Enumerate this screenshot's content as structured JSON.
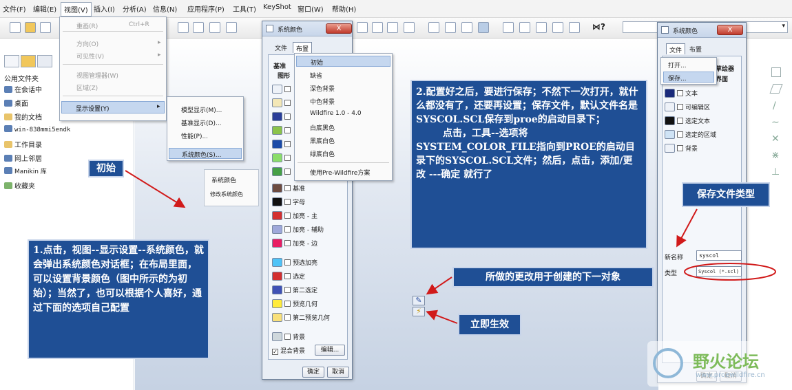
{
  "menubar": [
    "文件(F)",
    "编辑(E)",
    "视图(V)",
    "插入(I)",
    "分析(A)",
    "信息(N)",
    "应用程序(P)",
    "工具(T)",
    "KeyShot",
    "窗口(W)",
    "帮助(H)"
  ],
  "toolbar": {
    "help_glyph": "⋈?"
  },
  "left_panel": {
    "tree": [
      "公用文件夹",
      "在会话中",
      "桌面",
      "我的文档",
      "win-838mmi5endk",
      "工作目录",
      "网上邻居",
      "Manikin 库",
      "收藏夹"
    ]
  },
  "view_menu": {
    "items": [
      "重画(R)",
      "Ctrl+R",
      "方向(O)",
      "可见性(V)",
      "视图管理器(W)",
      "区域(Z)",
      "显示设置(Y)"
    ]
  },
  "display_submenu": [
    "模型显示(M)...",
    "基准显示(D)...",
    "性能(P)...",
    "系统颜色(S)..."
  ],
  "popup": [
    "系统颜色",
    "修改系统颜色"
  ],
  "dialog1": {
    "title": "系统颜色",
    "close": "X",
    "tabs": [
      "文件",
      "布置"
    ],
    "sub_tabs": [
      "基准",
      "图形"
    ],
    "rows": [
      "基准",
      "字母",
      "加亮 - 主",
      "加亮 - 辅助",
      "加亮 - 边",
      "预选加亮",
      "选定",
      "第二选定",
      "预览几何",
      "第二预览几何",
      "背景"
    ],
    "blend": "混合背景",
    "edit": "编辑...",
    "ok": "确定",
    "cancel": "取消"
  },
  "layout_menu": [
    "初始",
    "缺省",
    "深色背景",
    "中色背景",
    "Wildfire 1.0 - 4.0",
    "白底黑色",
    "黑底白色",
    "绿底白色",
    "使用Pre-Wildfire方案"
  ],
  "dialog2": {
    "title": "系统颜色",
    "close": "X",
    "tabs": [
      "文件",
      "布置"
    ],
    "file_menu": [
      "打开...",
      "保存..."
    ],
    "partial_tab": "草绘器",
    "partial_tab2": "界面",
    "rows": [
      "文本",
      "可编辑区",
      "选定文本",
      "选定的区域",
      "背景"
    ],
    "name_label": "新名称",
    "name_value": "syscol",
    "type_label": "类型",
    "type_value": "Syscol (*.scl)",
    "ok": "确定",
    "cancel": "取消"
  },
  "notes": {
    "initial": "初始",
    "step1": "1.点击，视图--显示设置--系统颜色，就会弹出系统颜色对话框；在布局里面，可以设置背景颜色（图中所示的为初始）；当然了，也可以根据个人喜好，通过下面的选项自己配置",
    "step2": "2.配置好之后，要进行保存；不然下一次打开，就什么都没有了，还要再设置；保存文件，默认文件名是SYSCOL.SCL保存到proe的启动目录下；\n        点击，工具--选项将SYSTEM_COLOR_FILE指向到PROE的启动目录下的SYSCOL.SCL文件；然后，点击，添加/更改 ---确定 就行了",
    "save_type": "保存文件类型",
    "apply_next": "所做的更改用于创建的下一对象",
    "apply_now": "立即生效"
  },
  "watermark": {
    "logo": "野火论坛",
    "url": "www.proewildfire.cn"
  },
  "colors": {
    "note_bg": "#1f4f95",
    "arrow": "#d11a1a"
  }
}
